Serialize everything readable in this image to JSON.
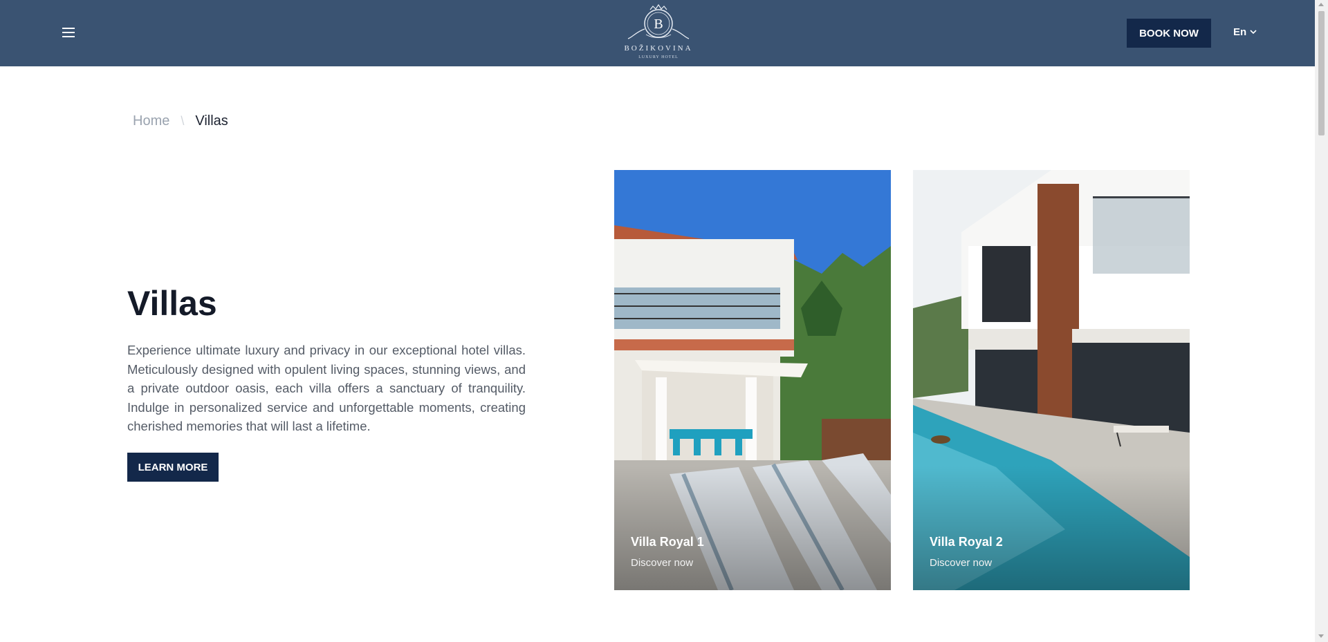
{
  "header": {
    "logo_letter": "B",
    "logo_word": "BOŽIKOVINA",
    "logo_sub": "LUXURY HOTEL",
    "book_label": "BOOK NOW",
    "language": "En"
  },
  "breadcrumb": {
    "home": "Home",
    "separator": "\\",
    "current": "Villas"
  },
  "intro": {
    "title": "Villas",
    "description": "Experience ultimate luxury and privacy in our exceptional hotel villas. Meticulously designed with opulent living spaces, stunning views, and a private outdoor oasis, each villa offers a sanctuary of tranquility. Indulge in personalized service and unforgettable moments, creating cherished memories that will last a lifetime.",
    "button": "LEARN MORE"
  },
  "cards": [
    {
      "title": "Villa Royal 1",
      "link": "Discover now"
    },
    {
      "title": "Villa Royal 2",
      "link": "Discover now"
    }
  ],
  "colors": {
    "header": "#3a5372",
    "button": "#13284a",
    "sky": "#3478d6",
    "pool": "#2ea3bb"
  }
}
